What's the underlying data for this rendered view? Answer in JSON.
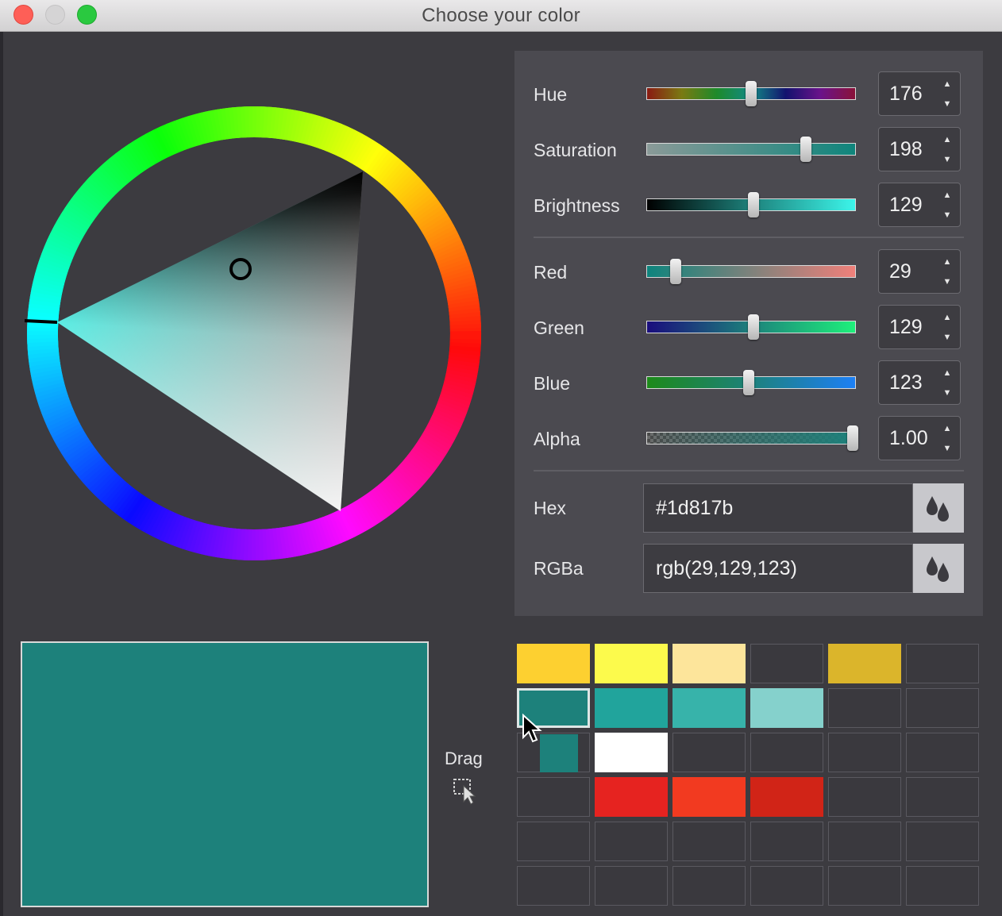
{
  "window": {
    "title": "Choose your color"
  },
  "current_color": "#1d817b",
  "wheel": {
    "hue_marker_deg": 176,
    "cursor_color": "#000000"
  },
  "sliders": [
    {
      "key": "hue",
      "label": "Hue",
      "value": "176",
      "fraction": 0.5
    },
    {
      "key": "saturation",
      "label": "Saturation",
      "value": "198",
      "fraction": 0.77
    },
    {
      "key": "brightness",
      "label": "Brightness",
      "value": "129",
      "fraction": 0.51
    },
    {
      "key": "red",
      "label": "Red",
      "value": "29",
      "fraction": 0.13
    },
    {
      "key": "green",
      "label": "Green",
      "value": "129",
      "fraction": 0.51
    },
    {
      "key": "blue",
      "label": "Blue",
      "value": "123",
      "fraction": 0.49
    },
    {
      "key": "alpha",
      "label": "Alpha",
      "value": "1.00",
      "fraction": 1.0
    }
  ],
  "spin_icons": {
    "up": "▲",
    "down": "▼"
  },
  "hex": {
    "label": "Hex",
    "value": "#1d817b",
    "picker_icon": "eyedropper-drops-icon"
  },
  "rgba": {
    "label": "RGBa",
    "value": "rgb(29,129,123)",
    "picker_icon": "eyedropper-drops-icon"
  },
  "drag": {
    "label": "Drag"
  },
  "swatches": {
    "cols": 6,
    "rows": [
      [
        "#fdd030",
        "#fcfa4c",
        "#fde59b",
        null,
        "#dbb52b",
        null
      ],
      [
        "#1d817b",
        "#21a49c",
        "#37b3aa",
        "#85d1cc",
        null,
        null
      ],
      [
        null,
        "#ffffff",
        null,
        null,
        null,
        null
      ],
      [
        null,
        "#e62320",
        "#f23a20",
        "#d12417",
        null,
        null
      ],
      [
        null,
        null,
        null,
        null,
        null,
        null
      ],
      [
        null,
        null,
        null,
        null,
        null,
        null
      ]
    ],
    "selected": {
      "row": 1,
      "col": 0
    }
  }
}
